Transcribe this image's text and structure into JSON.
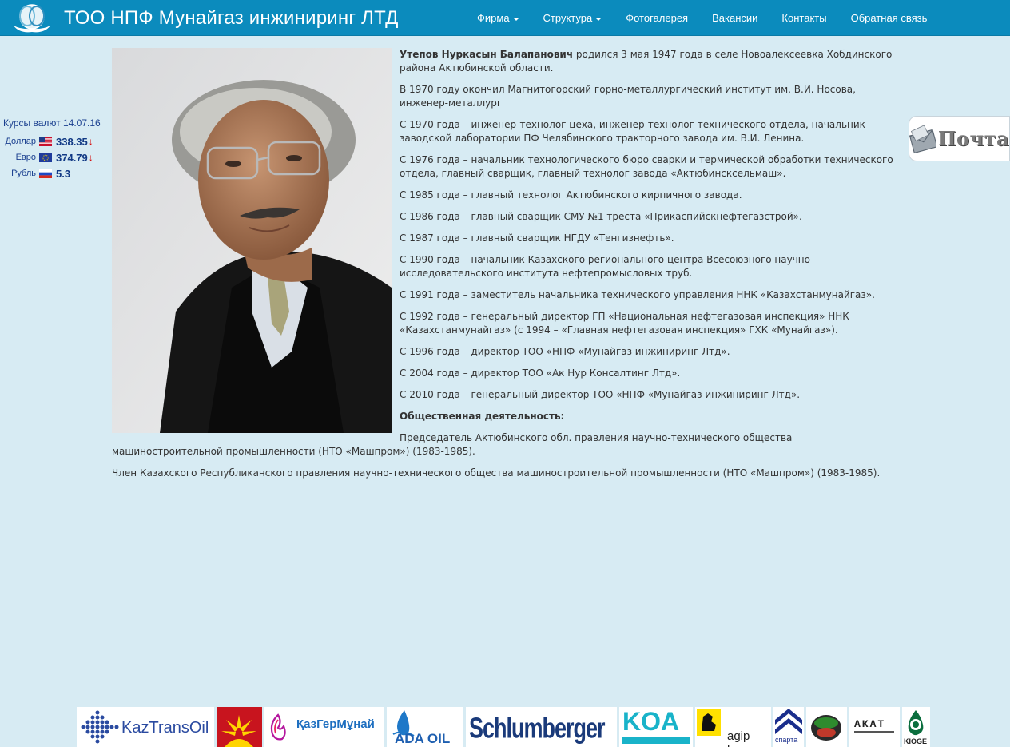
{
  "header": {
    "brand_title": "ТОО НПФ Мунайгаз инжиниринг ЛТД",
    "nav": [
      {
        "label": "Фирма",
        "dropdown": true
      },
      {
        "label": "Структура",
        "dropdown": true
      },
      {
        "label": "Фотогалерея",
        "dropdown": false
      },
      {
        "label": "Вакансии",
        "dropdown": false
      },
      {
        "label": "Контакты",
        "dropdown": false
      },
      {
        "label": "Обратная связь",
        "dropdown": false
      }
    ]
  },
  "rates": {
    "title": "Курсы валют 14.07.16",
    "items": [
      {
        "label": "Доллар",
        "flag": "us-flag",
        "value": "338.35",
        "trend": "↓"
      },
      {
        "label": "Евро",
        "flag": "eu-flag",
        "value": "374.79",
        "trend": "↓"
      },
      {
        "label": "Рубль",
        "flag": "ru-flag",
        "value": "5.3",
        "trend": ""
      }
    ]
  },
  "mail_widget": {
    "label": "Почта"
  },
  "bio": {
    "name": "Утепов Нуркасын Балапанович",
    "intro": " родился 3 мая 1947 года в селе Новоалексеевка Хобдинского района Актюбинской области.",
    "paragraphs": [
      "В 1970 году окончил Магнитогорский горно-металлургический институт им. В.И. Носова, инженер-металлург",
      "С 1970 года – инженер-технолог цеха, инженер-технолог технического отдела, начальник заводской лаборатории ПФ Челябинского тракторного завода им. В.И. Ленина.",
      "С 1976 года – начальник технологического бюро сварки и термической обработки технического отдела, главный сварщик, главный технолог завода «Актюбинсксельмаш».",
      "С 1985 года – главный технолог Актюбинского кирпичного завода.",
      "С 1986 года – главный сварщик СМУ №1 треста «Прикаспийскнефтегазстрой».",
      "С 1987 года – главный сварщик НГДУ «Тенгизнефть».",
      "С 1990 года – начальник Казахского регионального центра Всесоюзного научно-исследовательского института нефтепромысловых труб.",
      "С 1991 года – заместитель начальника технического управления ННК «Казахстанмунайгаз».",
      "С 1992 года – генеральный директор ГП «Национальная нефтегазовая инспекция» ННК «Казахстанмунайгаз» (с 1994 – «Главная нефтегазовая инспекция» ГХК «Мунайгаз»).",
      "С 1996 года – директор ТОО «НПФ «Мунайгаз инжиниринг Лтд».",
      "С 2004 года – директор ТОО «Ак Нур Консалтинг Лтд».",
      "С 2010 года – генеральный директор ТОО «НПФ «Мунайгаз инжиниринг Лтд»."
    ],
    "public_heading": "Общественная деятельность:",
    "public": [
      "Председатель Актюбинского обл. правления научно-технического общества машиностроительной промышленности (НТО «Машпром») (1983-1985).",
      "Член Казахского Республиканского правления научно-технического общества машиностроительной промышленности (НТО «Машпром») (1983-1985)."
    ]
  },
  "partners": [
    {
      "name": "kaztransoil-logo",
      "text": "KazTransOil"
    },
    {
      "name": "cnpc-logo",
      "text": ""
    },
    {
      "name": "kazgermunai-logo",
      "text": "ҚазГерМұнай"
    },
    {
      "name": "ada-oil-logo",
      "text": "ADA OIL"
    },
    {
      "name": "schlumberger-logo",
      "text": "Schlumberger"
    },
    {
      "name": "kazakhoil-aktobe-logo",
      "text": "KOA"
    },
    {
      "name": "eni-agip-kco-logo",
      "text": "agip kco"
    },
    {
      "name": "sparta-logo",
      "text": "спарта"
    },
    {
      "name": "round-logo",
      "text": ""
    },
    {
      "name": "akat-logo",
      "text": "АКАТ"
    },
    {
      "name": "kioge-logo",
      "text": "KIOGE"
    }
  ]
}
